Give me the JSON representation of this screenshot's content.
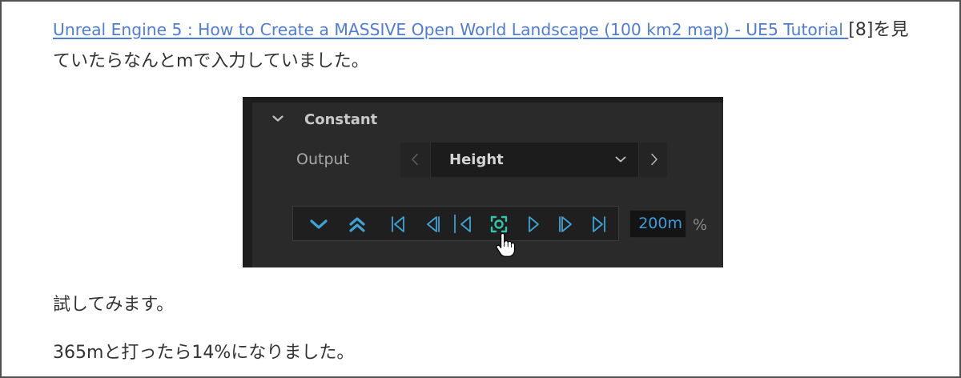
{
  "article": {
    "intro": {
      "link_text": "Unreal Engine 5 : How to Create a MASSIVE Open World Landscape (100 km2 map) - UE5 Tutorial ",
      "line1_text": "[8]を見",
      "line2_text": "ていたらなんとmで入力していました。"
    },
    "try_text": "試してみます。",
    "result_text": "365mと打ったら14%になりました。"
  },
  "ue_screenshot": {
    "section": {
      "icon": "chevron-down-icon",
      "title": "Constant"
    },
    "output_row": {
      "label": "Output",
      "prev_icon": "chevron-left-icon",
      "value": "Height",
      "dropdown_icon": "chevron-down-icon",
      "next_icon": "chevron-right-icon"
    },
    "toolbar": {
      "icons": [
        "chevron-down-icon",
        "double-chevron-up-icon",
        "skip-to-start-icon",
        "step-back-icon",
        "previous-icon",
        "focus-icon",
        "next-icon",
        "step-forward-icon",
        "skip-to-end-icon"
      ],
      "cursor_icon": "hand-cursor-icon",
      "value": "200m",
      "unit": "%"
    }
  },
  "colors": {
    "text": "#333333",
    "link": "#4f7dd5",
    "panel_background": "#2a2a2a",
    "toolbar_icon": "#3fa2d4",
    "focus_icon": "#2fc6a9",
    "value_text": "#3d9ce0"
  }
}
